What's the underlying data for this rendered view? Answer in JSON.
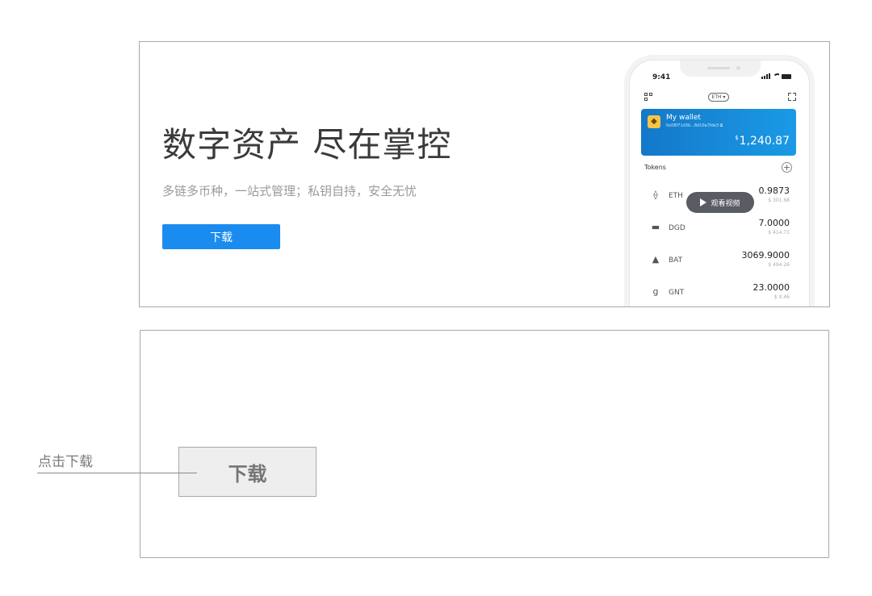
{
  "hero": {
    "title": "数字资产 尽在掌控",
    "subtitle": "多链多币种，一站式管理；私钥自持，安全无忧",
    "download_label": "下载"
  },
  "phone": {
    "status_time": "9:41",
    "network_pill": "ETH ▾",
    "wallet": {
      "name": "My wallet",
      "address": "0x08f71d3b...8d10a7fde3 ⧉",
      "balance_symbol": "$",
      "balance": "1,240.87"
    },
    "tokens_label": "Tokens",
    "add_symbol": "+",
    "video_label": "观看视频",
    "tokens": [
      {
        "name": "ETH",
        "icon": "ethereum-icon",
        "glyph": "⟠",
        "amount": "0.9873",
        "fiat": "$ 301.68"
      },
      {
        "name": "DGD",
        "icon": "digix-icon",
        "glyph": "▬",
        "amount": "7.0000",
        "fiat": "$ 414.71"
      },
      {
        "name": "BAT",
        "icon": "bat-icon",
        "glyph": "▲",
        "amount": "3069.9000",
        "fiat": "$ 494.26"
      },
      {
        "name": "GNT",
        "icon": "golem-icon",
        "glyph": "g",
        "amount": "23.0000",
        "fiat": "$ 0.46"
      }
    ]
  },
  "wireframe": {
    "download_label": "下载",
    "annotation": "点击下载"
  },
  "colors": {
    "accent_blue": "#1a8cf0",
    "card_gradient_start": "#1478c9",
    "card_gradient_end": "#1a9ae6",
    "frame_border": "#a9a9a9"
  }
}
